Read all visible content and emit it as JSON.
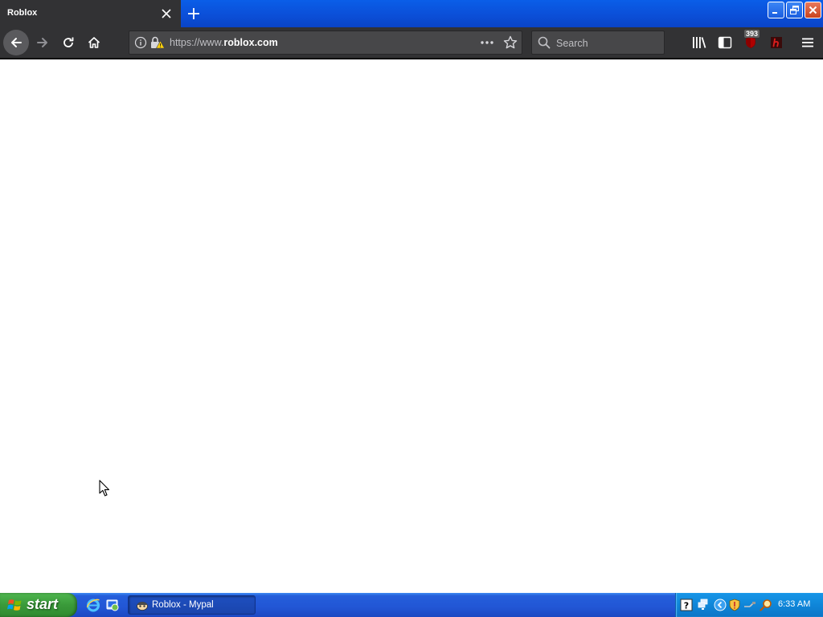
{
  "tab": {
    "title": "Roblox"
  },
  "urlbar": {
    "url_prefix": "https://www.",
    "url_domain": "roblox.com"
  },
  "search": {
    "placeholder": "Search"
  },
  "extensions": {
    "ublock_badge": "393"
  },
  "taskbar": {
    "start_label": "start",
    "task_label": "Roblox - Mypal",
    "clock": "6:33 AM"
  },
  "colors": {
    "toolbar": "#323234",
    "titlebar_blue": "#0b4fd8",
    "start_green": "#3a9a3a",
    "taskbar_blue": "#245edb",
    "tray_blue": "#0f86d9"
  }
}
